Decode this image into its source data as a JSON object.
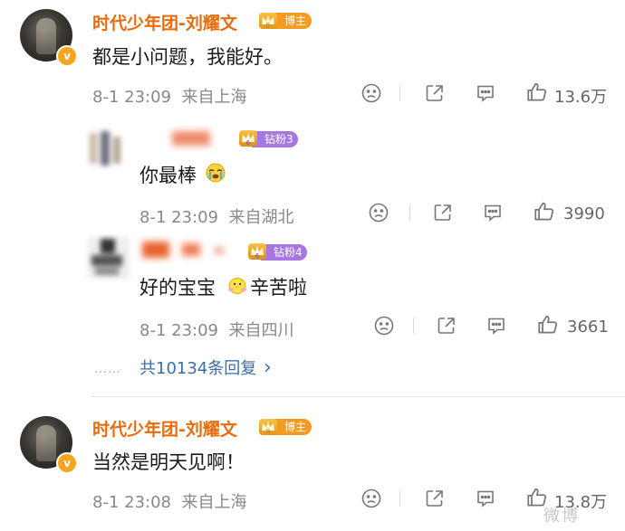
{
  "colors": {
    "name": "#e86b0c",
    "meta": "#888888",
    "link": "#3b6fa8",
    "blogger_tag": "#f59b1f",
    "fan_tag": "#a776e3"
  },
  "comments": [
    {
      "author": "时代少年团-刘耀文",
      "badge_level": "9",
      "badge_label": "博主",
      "text": "都是小问题，我能好。",
      "time": "8-1 23:09",
      "location": "来自上海",
      "likes": "13.6万"
    },
    {
      "author": "时代少年团-刘耀文",
      "badge_level": "9",
      "badge_label": "博主",
      "text": "当然是明天见啊！",
      "time": "8-1 23:08",
      "location": "来自上海",
      "likes": "13.8万"
    }
  ],
  "replies": [
    {
      "badge_level": "6",
      "badge_label": "钻粉3",
      "text": "你最棒",
      "emoji": "crying-face-emoji",
      "time": "8-1 23:09",
      "location": "来自湖北",
      "likes": "3990"
    },
    {
      "badge_level": "6",
      "badge_label": "钻粉4",
      "text_before": "好的宝宝",
      "emoji": "hugging-chick-emoji",
      "text_after": "辛苦啦",
      "time": "8-1 23:09",
      "location": "来自四川",
      "likes": "3661"
    }
  ],
  "more_replies": {
    "dots": "……",
    "label": "共10134条回复",
    "chevron": "›"
  },
  "icons": [
    "sad-face-icon",
    "share-icon",
    "comment-icon",
    "like-icon",
    "chevron-right-icon"
  ],
  "watermark": "微博"
}
